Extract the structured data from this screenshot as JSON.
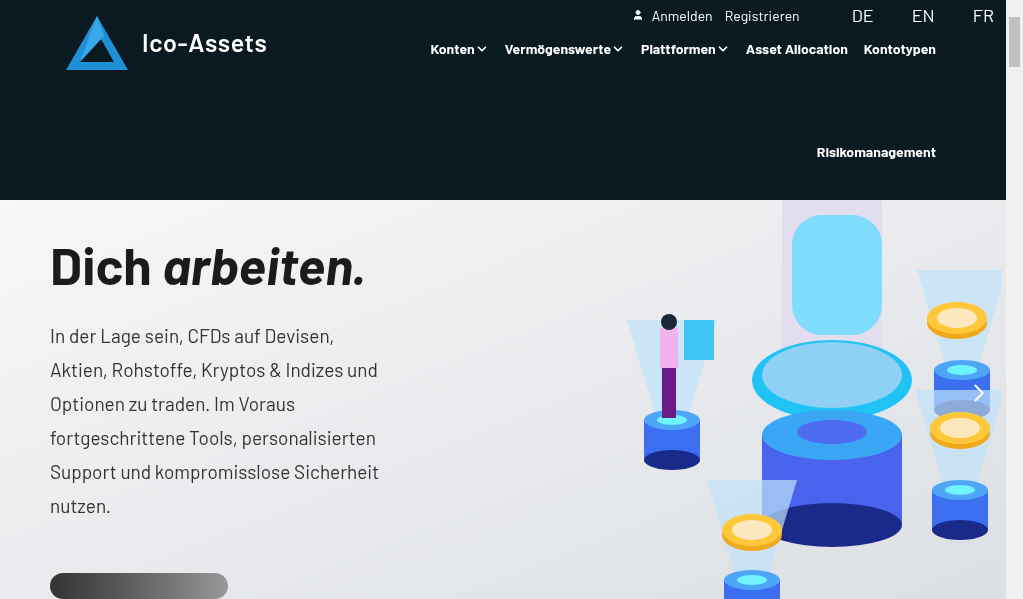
{
  "header": {
    "brand": "Ico-Assets",
    "account_links": [
      {
        "label": "Anmelden",
        "icon": true
      },
      {
        "label": "Registrieren",
        "icon": false
      }
    ],
    "languages": [
      {
        "label": "DE"
      },
      {
        "label": "EN"
      },
      {
        "label": "FR"
      }
    ],
    "nav": [
      {
        "label": "Konten",
        "dropdown": true
      },
      {
        "label": "Vermögenswerte",
        "dropdown": true
      },
      {
        "label": "Plattformen",
        "dropdown": true
      },
      {
        "label": "Asset Allocation",
        "dropdown": false
      },
      {
        "label": "Kontotypen",
        "dropdown": false
      },
      {
        "label": "Risikomanagement",
        "dropdown": false
      }
    ]
  },
  "hero": {
    "heading": "Dich *arbeiten.*",
    "text": "In der Lage sein, CFDs auf Devisen, Aktien, Rohstoffe, Kryptos & Indizes und Optionen zu traden. Im Voraus fortgeschrittene Tools, personalisierten Support und kompromisslose Sicherheit nutzen."
  }
}
